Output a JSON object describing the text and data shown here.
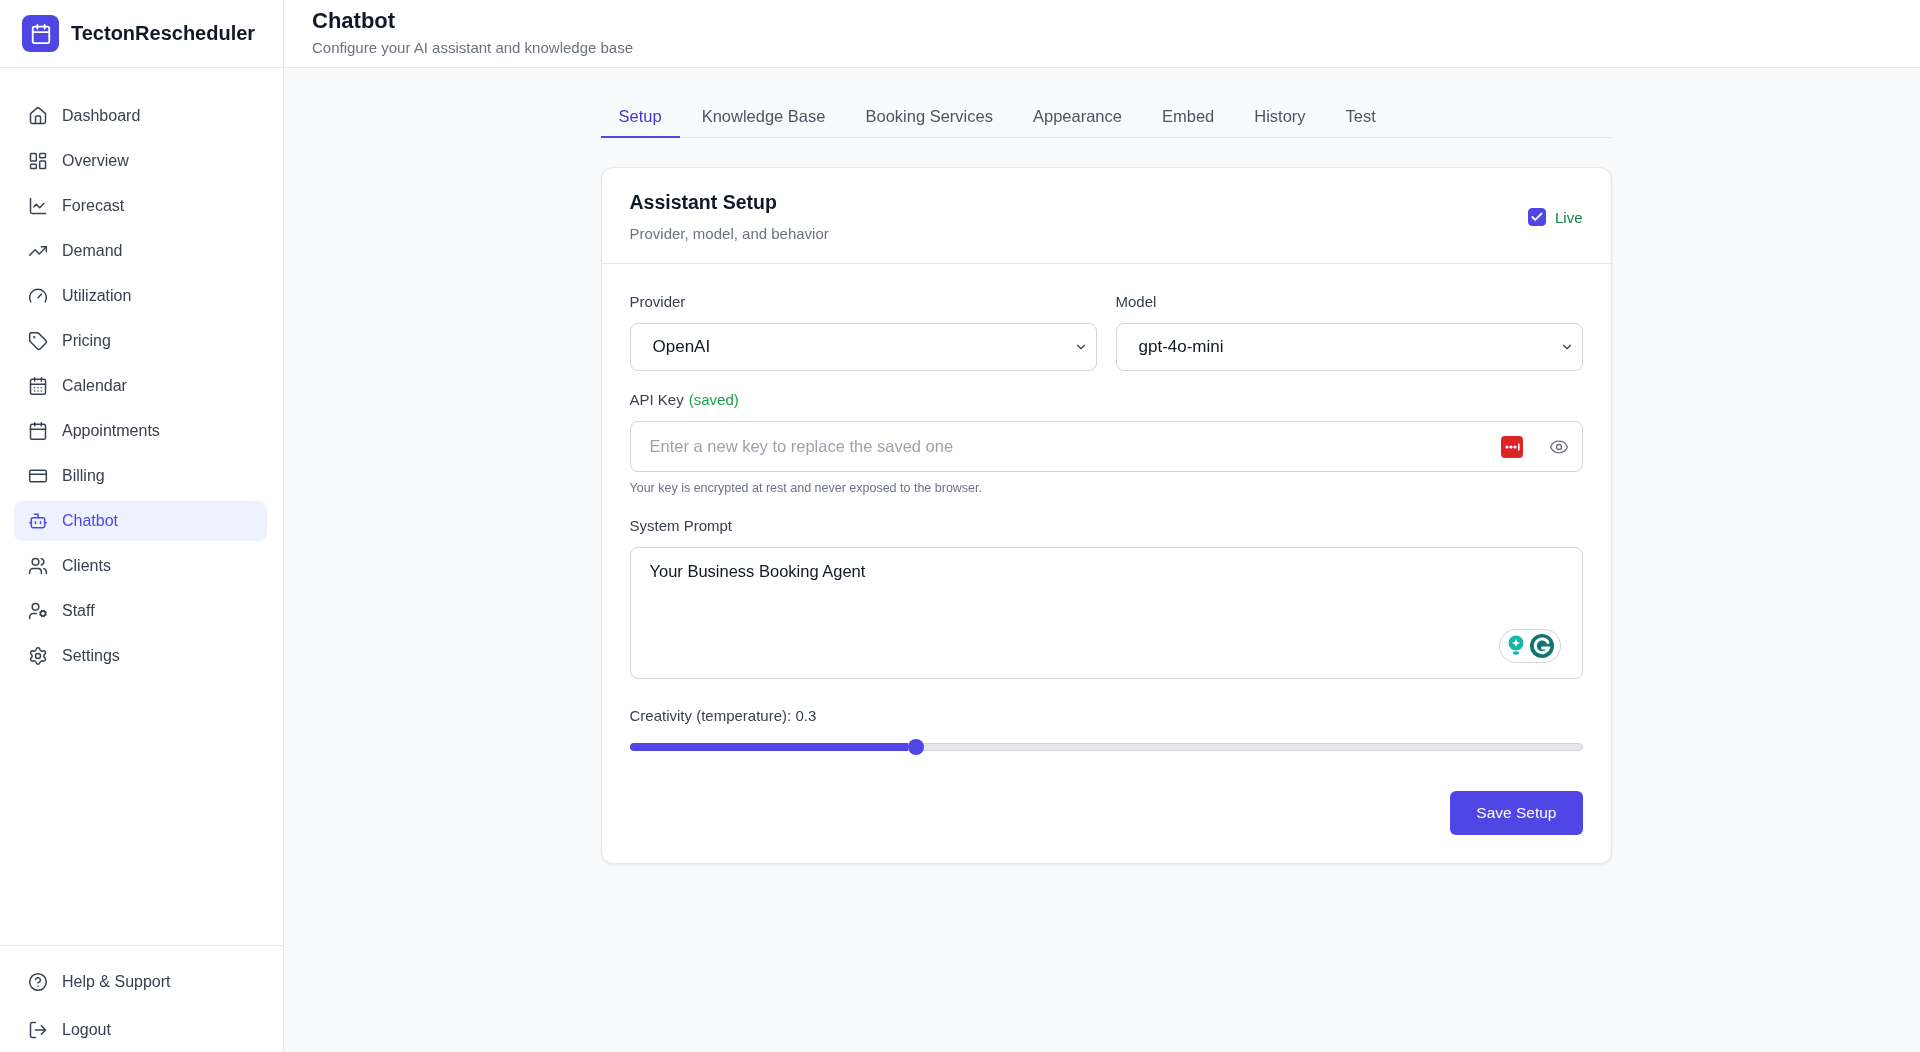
{
  "app": {
    "name": "TectonRescheduler"
  },
  "sidebar": {
    "items": [
      {
        "label": "Dashboard",
        "selected": false
      },
      {
        "label": "Overview",
        "selected": false
      },
      {
        "label": "Forecast",
        "selected": false
      },
      {
        "label": "Demand",
        "selected": false
      },
      {
        "label": "Utilization",
        "selected": false
      },
      {
        "label": "Pricing",
        "selected": false
      },
      {
        "label": "Calendar",
        "selected": false
      },
      {
        "label": "Appointments",
        "selected": false
      },
      {
        "label": "Billing",
        "selected": false
      },
      {
        "label": "Chatbot",
        "selected": true
      },
      {
        "label": "Clients",
        "selected": false
      },
      {
        "label": "Staff",
        "selected": false
      },
      {
        "label": "Settings",
        "selected": false
      }
    ],
    "footer_items": [
      {
        "label": "Help & Support"
      },
      {
        "label": "Logout"
      }
    ]
  },
  "header": {
    "title": "Chatbot",
    "subtitle": "Configure your AI assistant and knowledge base"
  },
  "tabs": [
    {
      "label": "Setup",
      "selected": true
    },
    {
      "label": "Knowledge Base",
      "selected": false
    },
    {
      "label": "Booking Services",
      "selected": false
    },
    {
      "label": "Appearance",
      "selected": false
    },
    {
      "label": "Embed",
      "selected": false
    },
    {
      "label": "History",
      "selected": false
    },
    {
      "label": "Test",
      "selected": false
    }
  ],
  "card": {
    "title": "Assistant Setup",
    "subtitle": "Provider, model, and behavior",
    "live": {
      "label": "Live",
      "checked": true
    },
    "provider": {
      "label": "Provider",
      "value": "OpenAI"
    },
    "model": {
      "label": "Model",
      "value": "gpt-4o-mini"
    },
    "api_key": {
      "label": "API Key",
      "status": "(saved)",
      "placeholder": "Enter a new key to replace the saved one",
      "hint": "Your key is encrypted at rest and never exposed to the browser."
    },
    "system_prompt": {
      "label": "System Prompt",
      "value": "Your Business Booking Agent"
    },
    "creativity": {
      "label": "Creativity (temperature): 0.3",
      "level": 0.3
    },
    "save_button": "Save Setup"
  }
}
